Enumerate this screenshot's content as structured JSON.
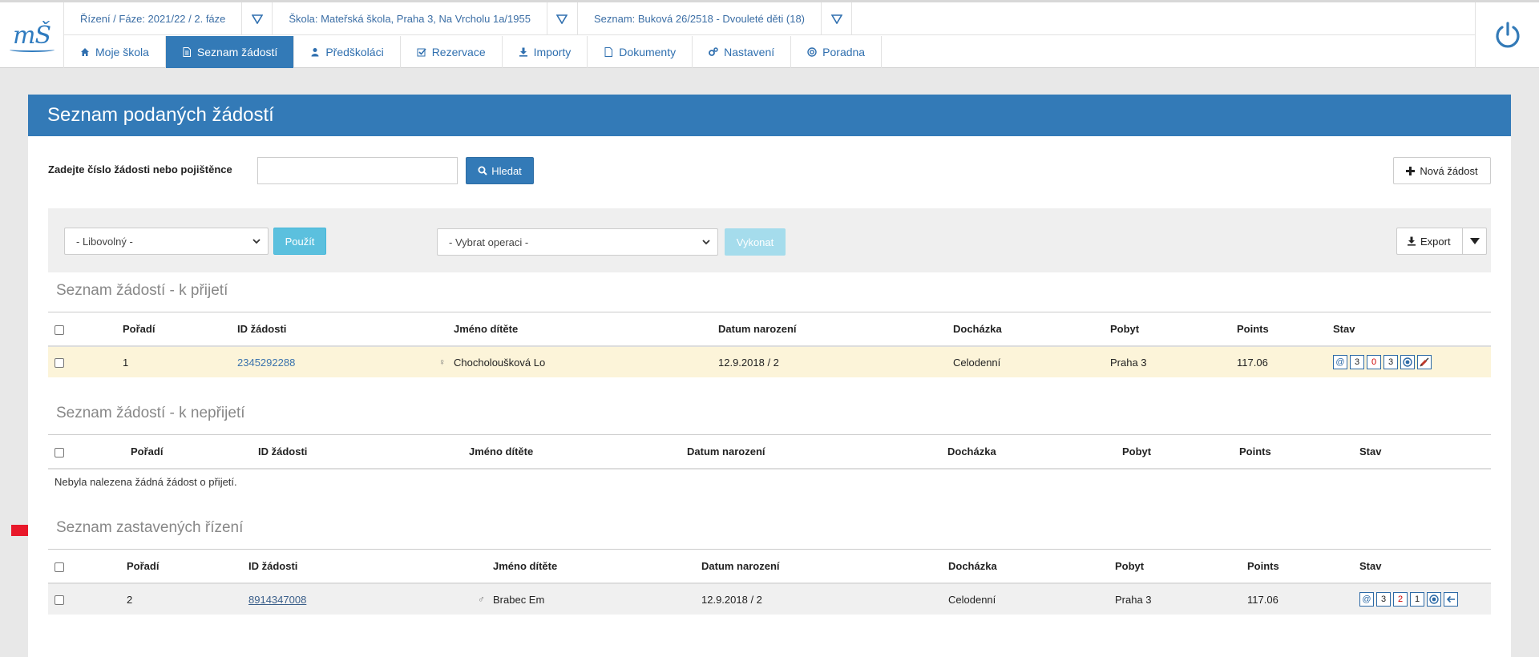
{
  "header": {
    "logo": "mŠ",
    "selectors": [
      "Řízení / Fáze: 2021/22 / 2. fáze",
      "Škola: Mateřská škola, Praha 3, Na Vrcholu 1a/1955",
      "Seznam: Buková 26/2518 - Dvouleté děti (18)"
    ],
    "tabs": [
      {
        "label": "Moje škola",
        "icon": "home-icon"
      },
      {
        "label": "Seznam žádostí",
        "icon": "file-icon"
      },
      {
        "label": "Předškoláci",
        "icon": "user-icon"
      },
      {
        "label": "Rezervace",
        "icon": "check-square-icon"
      },
      {
        "label": "Importy",
        "icon": "download-icon"
      },
      {
        "label": "Dokumenty",
        "icon": "document-icon"
      },
      {
        "label": "Nastavení",
        "icon": "gears-icon"
      },
      {
        "label": "Poradna",
        "icon": "lifebuoy-icon"
      }
    ],
    "active_tab": "Seznam žádostí",
    "accent": "#337ab7"
  },
  "panel": {
    "title": "Seznam podaných žádostí",
    "search_label": "Zadejte číslo žádosti nebo pojištěnce",
    "search_value": "",
    "search_button": "Hledat",
    "new_button": "Nová žádost",
    "filter_select": "- Libovolný -",
    "apply_button": "Použít",
    "operation_select": "- Vybrat operaci -",
    "execute_button": "Vykonat",
    "export_button": "Export"
  },
  "columns": [
    "Pořadí",
    "ID žádosti",
    "Jméno dítěte",
    "Datum narození",
    "Docházka",
    "Pobyt",
    "Points",
    "Stav"
  ],
  "sections": {
    "accepted": {
      "title": "Seznam žádostí - k přijetí",
      "rows": [
        {
          "order": "1",
          "id": "2345292288",
          "gender": "♀",
          "name": "Chocholoušková Lo",
          "birth": "12.9.2018 / 2",
          "attendance": "Celodenní",
          "residence": "Praha 3",
          "points": "117.06",
          "status": [
            "@",
            "3",
            "0",
            "3"
          ]
        }
      ]
    },
    "rejected": {
      "title": "Seznam žádostí - k nepřijetí",
      "empty_text": "Nebyla nalezena žádná žádost o přijetí."
    },
    "stopped": {
      "title": "Seznam zastavených řízení",
      "rows": [
        {
          "order": "2",
          "id": "8914347008",
          "gender": "♂",
          "name": "Brabec Em",
          "birth": "12.9.2018 / 2",
          "attendance": "Celodenní",
          "residence": "Praha 3",
          "points": "117.06",
          "status": [
            "@",
            "3",
            "2",
            "1"
          ]
        }
      ]
    }
  }
}
